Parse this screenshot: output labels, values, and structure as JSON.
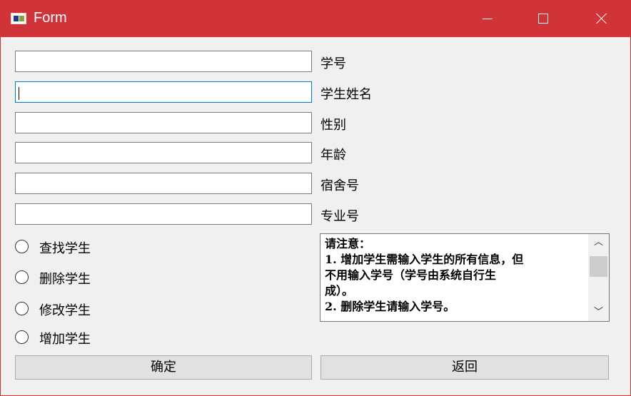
{
  "window": {
    "title": "Form"
  },
  "fields": [
    {
      "label": "学号",
      "value": ""
    },
    {
      "label": "学生姓名",
      "value": ""
    },
    {
      "label": "性别",
      "value": ""
    },
    {
      "label": "年龄",
      "value": ""
    },
    {
      "label": "宿舍号",
      "value": ""
    },
    {
      "label": "专业号",
      "value": ""
    }
  ],
  "radios": [
    {
      "label": "查找学生",
      "checked": false
    },
    {
      "label": "删除学生",
      "checked": false
    },
    {
      "label": "修改学生",
      "checked": false
    },
    {
      "label": "增加学生",
      "checked": false
    }
  ],
  "notes": {
    "text": "请注意：\n1. 增加学生需输入学生的所有信息，但\n不用输入学号（学号由系统自行生\n成）。\n2. 删除学生请输入学号。"
  },
  "buttons": {
    "confirm": "确定",
    "back": "返回"
  },
  "icons": {
    "app": "app-form-icon",
    "minimize": "minimize-icon",
    "maximize": "maximize-icon",
    "close": "close-icon",
    "scroll_up": "chevron-up-icon",
    "scroll_down": "chevron-down-icon"
  },
  "colors": {
    "titlebar": "#d13438",
    "focus_border": "#0078d7"
  }
}
